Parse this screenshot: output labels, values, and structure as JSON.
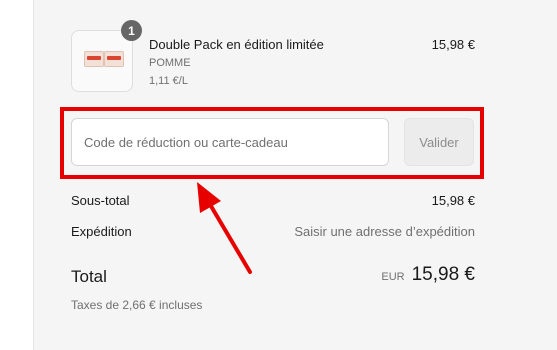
{
  "cart": {
    "item": {
      "quantity_badge": "1",
      "name": "Double Pack en édition limitée",
      "vendor": "POMME",
      "unit_price": "1,11 €/L",
      "price": "15,98 €",
      "image_icon": "product-thumbnail-icon"
    },
    "discount": {
      "placeholder": "Code de réduction ou carte-cadeau",
      "value": "",
      "apply_label": "Valider"
    },
    "summary": {
      "subtotal_label": "Sous-total",
      "subtotal_value": "15,98 €",
      "shipping_label": "Expédition",
      "shipping_value": "Saisir une adresse d’expédition",
      "total_label": "Total",
      "currency": "EUR",
      "total_value": "15,98 €",
      "tax_note": "Taxes de 2,66 € incluses"
    }
  },
  "annotation": {
    "highlight_color": "#e60000",
    "arrow_icon": "red-arrow-icon"
  }
}
